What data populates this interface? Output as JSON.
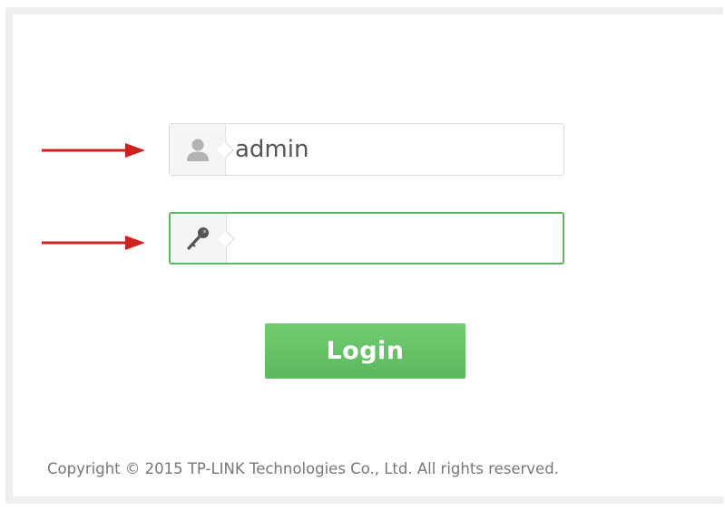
{
  "login_form": {
    "username_value": "admin",
    "password_value": "",
    "username_icon": "user-icon",
    "password_icon": "key-icon",
    "login_label": "Login"
  },
  "annotations": {
    "arrow_color": "#cc2222"
  },
  "footer": {
    "copyright": "Copyright © 2015 TP-LINK Technologies Co., Ltd. All rights reserved."
  },
  "colors": {
    "accent_green": "#5cb85c",
    "button_green": "#62c262"
  }
}
